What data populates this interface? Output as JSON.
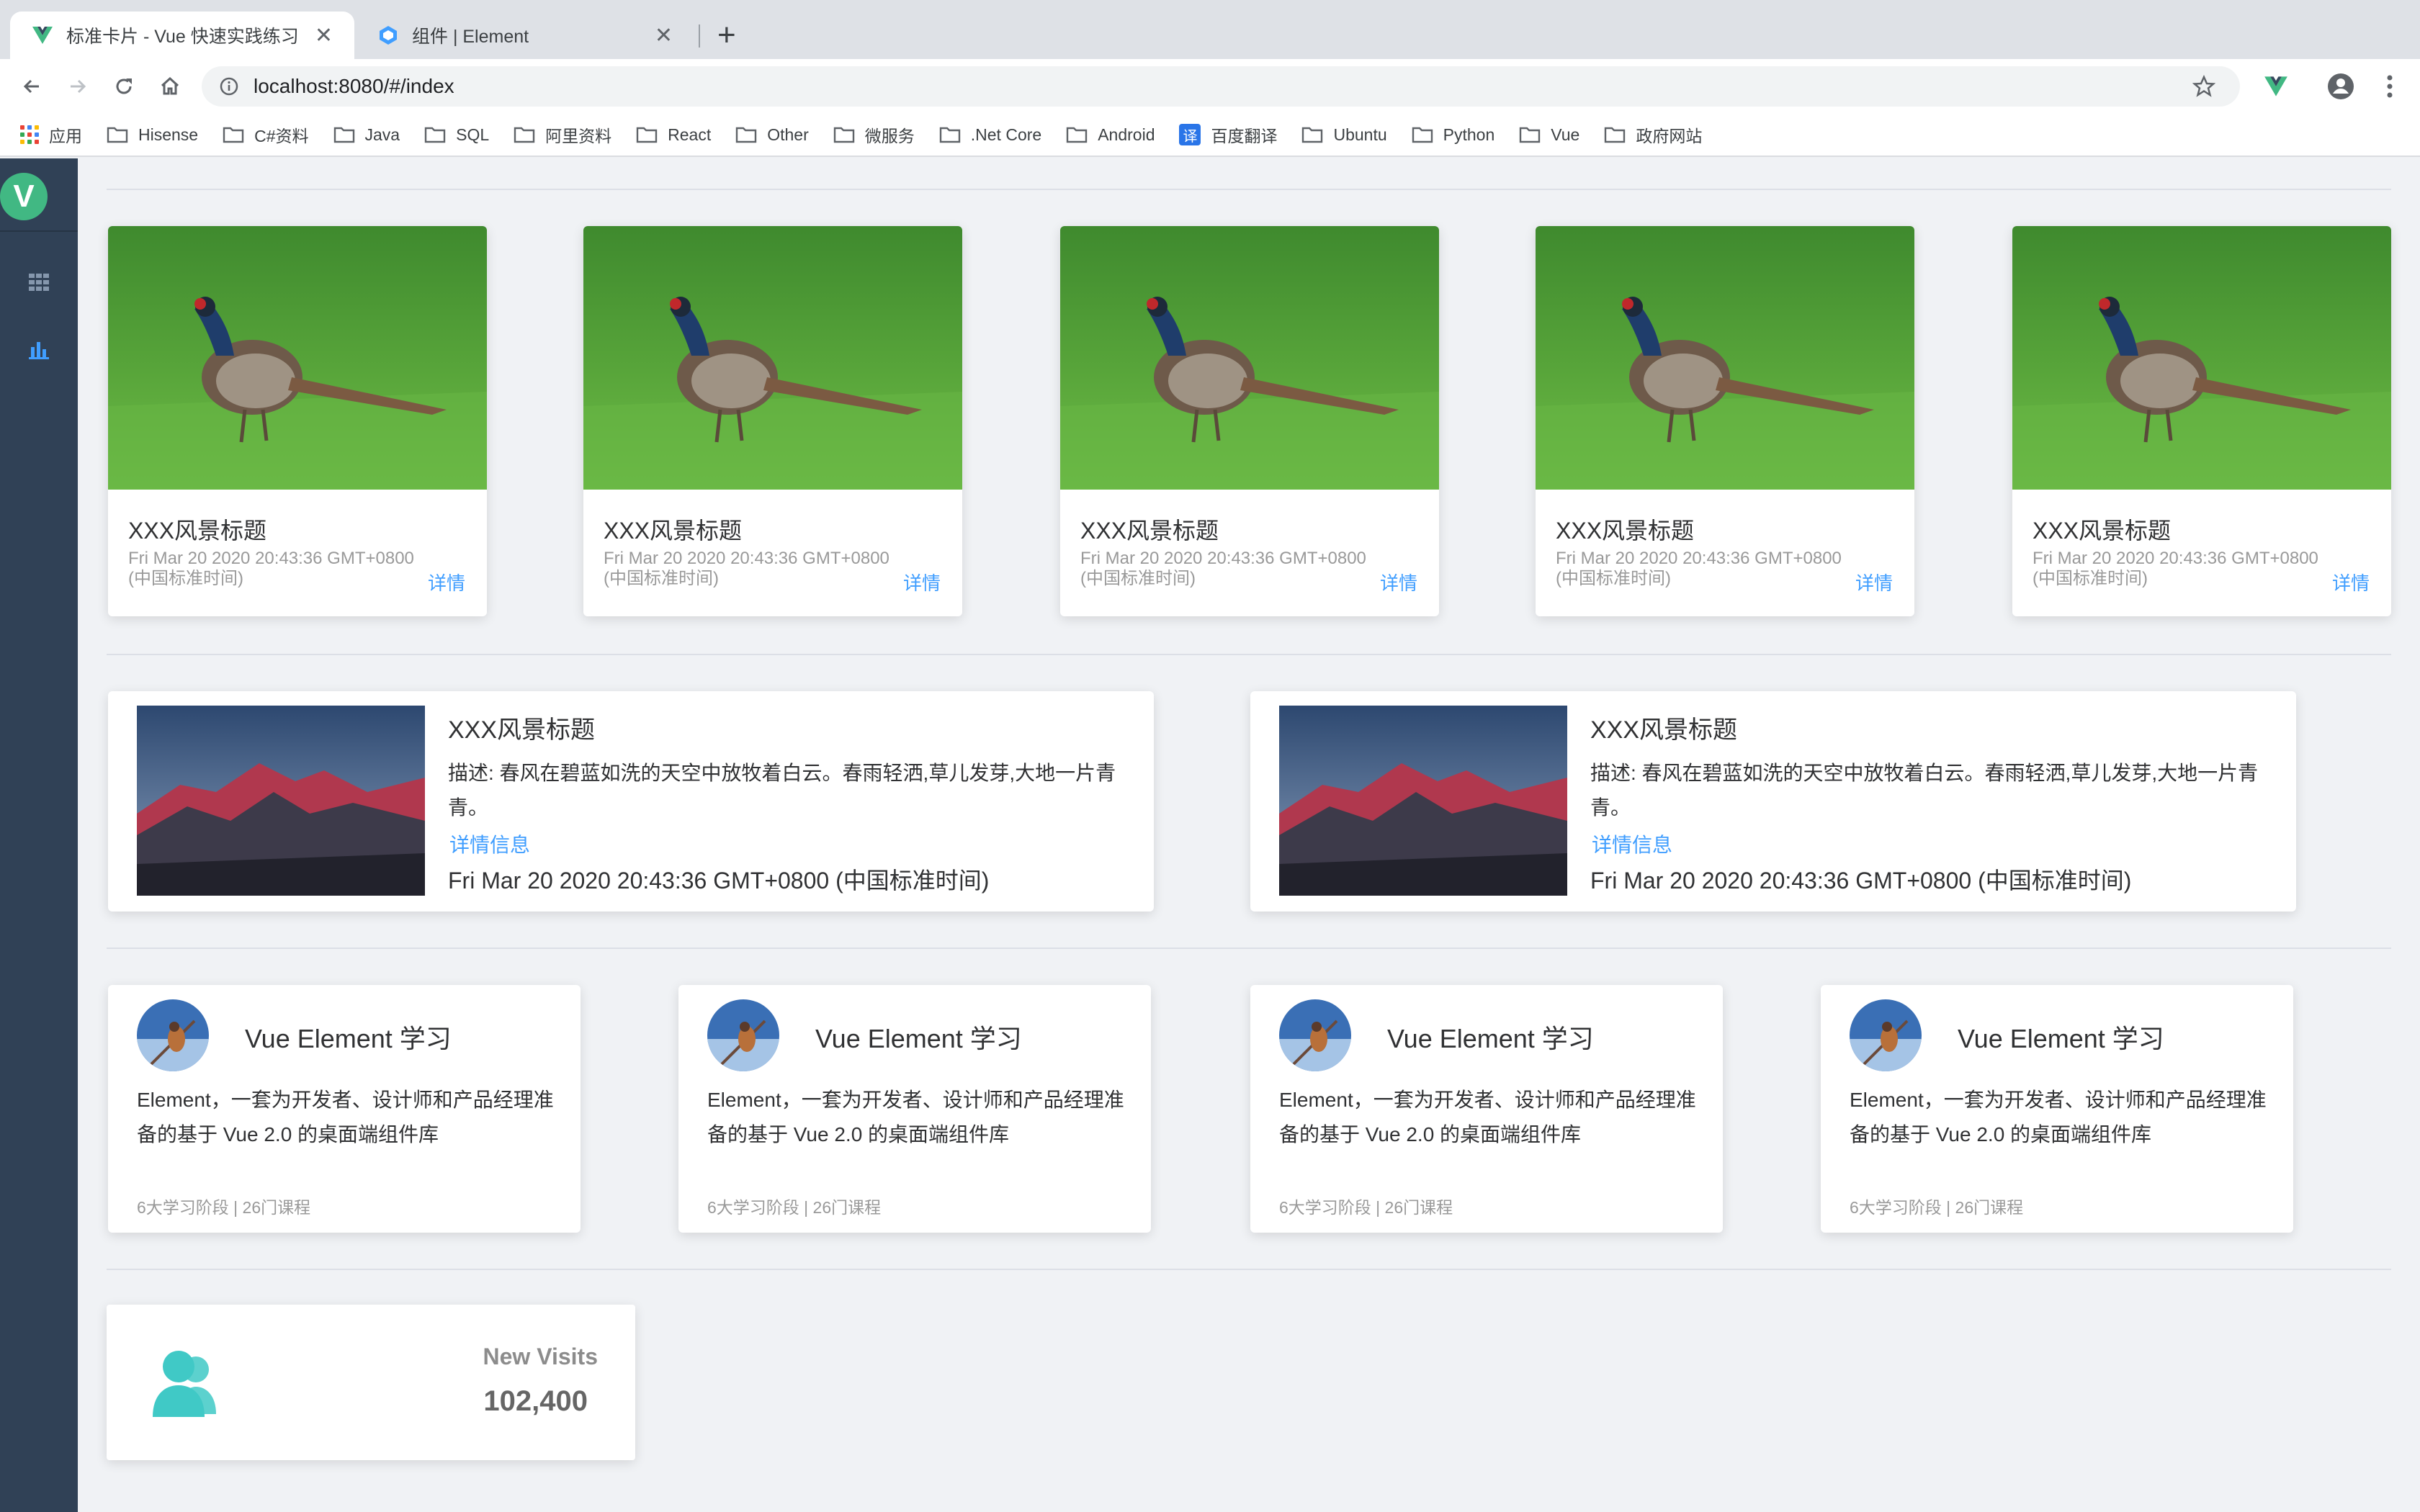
{
  "browser": {
    "tabs": [
      {
        "title": "标准卡片 - Vue 快速实践练习",
        "active": true,
        "icon": "vue-logo-icon"
      },
      {
        "title": "组件 | Element",
        "active": false,
        "icon": "element-logo-icon"
      }
    ],
    "url": "localhost:8080/#/index",
    "bookmarks": [
      "应用",
      "Hisense",
      "C#资料",
      "Java",
      "SQL",
      "阿里资料",
      "React",
      "Other",
      "微服务",
      ".Net Core",
      "Android",
      "百度翻译",
      "Ubuntu",
      "Python",
      "Vue",
      "政府网站"
    ],
    "translate_badge": "译"
  },
  "sidebar": {
    "logo_letter": "V",
    "items": [
      {
        "icon": "grid-icon"
      },
      {
        "icon": "bar-chart-icon"
      }
    ]
  },
  "photo_cards": [
    {
      "title": "XXX风景标题",
      "time": "Fri Mar 20 2020 20:43:36 GMT+0800 (中国标准时间)",
      "detail": "详情"
    },
    {
      "title": "XXX风景标题",
      "time": "Fri Mar 20 2020 20:43:36 GMT+0800 (中国标准时间)",
      "detail": "详情"
    },
    {
      "title": "XXX风景标题",
      "time": "Fri Mar 20 2020 20:43:36 GMT+0800 (中国标准时间)",
      "detail": "详情"
    },
    {
      "title": "XXX风景标题",
      "time": "Fri Mar 20 2020 20:43:36 GMT+0800 (中国标准时间)",
      "detail": "详情"
    },
    {
      "title": "XXX风景标题",
      "time": "Fri Mar 20 2020 20:43:36 GMT+0800 (中国标准时间)",
      "detail": "详情"
    }
  ],
  "landscape_cards": [
    {
      "title": "XXX风景标题",
      "description": "描述: 春风在碧蓝如洗的天空中放牧着白云。春雨轻洒,草儿发芽,大地一片青青。",
      "link": "详情信息",
      "time": "Fri Mar 20 2020 20:43:36 GMT+0800 (中国标准时间)"
    },
    {
      "title": "XXX风景标题",
      "description": "描述: 春风在碧蓝如洗的天空中放牧着白云。春雨轻洒,草儿发芽,大地一片青青。",
      "link": "详情信息",
      "time": "Fri Mar 20 2020 20:43:36 GMT+0800 (中国标准时间)"
    }
  ],
  "course_cards": [
    {
      "title": "Vue Element 学习",
      "description": "Element，一套为开发者、设计师和产品经理准备的基于 Vue 2.0 的桌面端组件库",
      "meta": "6大学习阶段 | 26门课程"
    },
    {
      "title": "Vue Element 学习",
      "description": "Element，一套为开发者、设计师和产品经理准备的基于 Vue 2.0 的桌面端组件库",
      "meta": "6大学习阶段 | 26门课程"
    },
    {
      "title": "Vue Element 学习",
      "description": "Element，一套为开发者、设计师和产品经理准备的基于 Vue 2.0 的桌面端组件库",
      "meta": "6大学习阶段 | 26门课程"
    },
    {
      "title": "Vue Element 学习",
      "description": "Element，一套为开发者、设计师和产品经理准备的基于 Vue 2.0 的桌面端组件库",
      "meta": "6大学习阶段 | 26门课程"
    }
  ],
  "stat_card": {
    "label": "New Visits",
    "value": "102,400",
    "icon": "users-icon",
    "color": "#40c9c6"
  },
  "colors": {
    "link": "#409eff",
    "sidebar": "#304156",
    "vue_green": "#41b883"
  }
}
